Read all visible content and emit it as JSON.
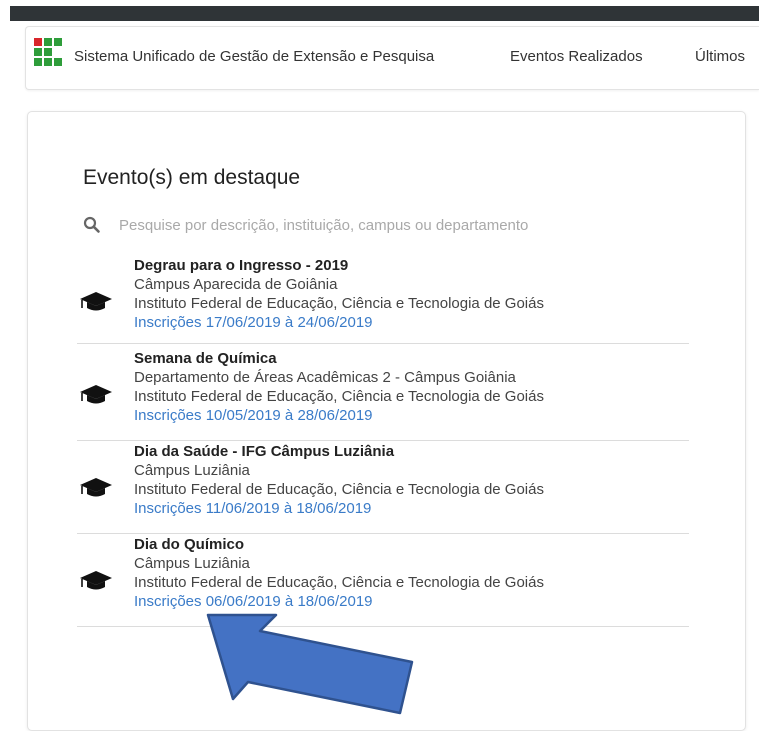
{
  "navbar": {
    "brand": "Sistema Unificado de Gestão de Extensão e Pesquisa",
    "links": [
      "Eventos Realizados",
      "Últimos"
    ]
  },
  "featured": {
    "title": "Evento(s) em destaque",
    "search_placeholder": "Pesquise por descrição, instituição, campus ou departamento",
    "events": [
      {
        "name": "Degrau para o Ingresso - 2019",
        "campus": "Câmpus Aparecida de Goiânia",
        "institution": "Instituto Federal de Educação, Ciência e Tecnologia de Goiás",
        "registration": "Inscrições 17/06/2019 à 24/06/2019"
      },
      {
        "name": "Semana de Química",
        "campus": "Departamento de Áreas Acadêmicas 2 - Câmpus Goiânia",
        "institution": "Instituto Federal de Educação, Ciência e Tecnologia de Goiás",
        "registration": "Inscrições 10/05/2019 à 28/06/2019"
      },
      {
        "name": "Dia da Saúde - IFG Câmpus Luziânia",
        "campus": "Câmpus Luziânia",
        "institution": "Instituto Federal de Educação, Ciência e Tecnologia de Goiás",
        "registration": "Inscrições 11/06/2019 à 18/06/2019"
      },
      {
        "name": "Dia do Químico",
        "campus": "Câmpus Luziânia",
        "institution": "Instituto Federal de Educação, Ciência e Tecnologia de Goiás",
        "registration": "Inscrições 06/06/2019 à 18/06/2019"
      }
    ]
  },
  "icons": {
    "logo": "ifg-logo-icon",
    "search": "search-icon",
    "event": "graduation-cap-icon",
    "annotation": "arrow-annotation"
  },
  "colors": {
    "logo_green": "#2e9d3a",
    "logo_red": "#d8262b",
    "link_blue": "#3a7bc8",
    "arrow_blue": "#4472c4",
    "arrow_border": "#2f528f",
    "top_bar": "#2f3437"
  }
}
